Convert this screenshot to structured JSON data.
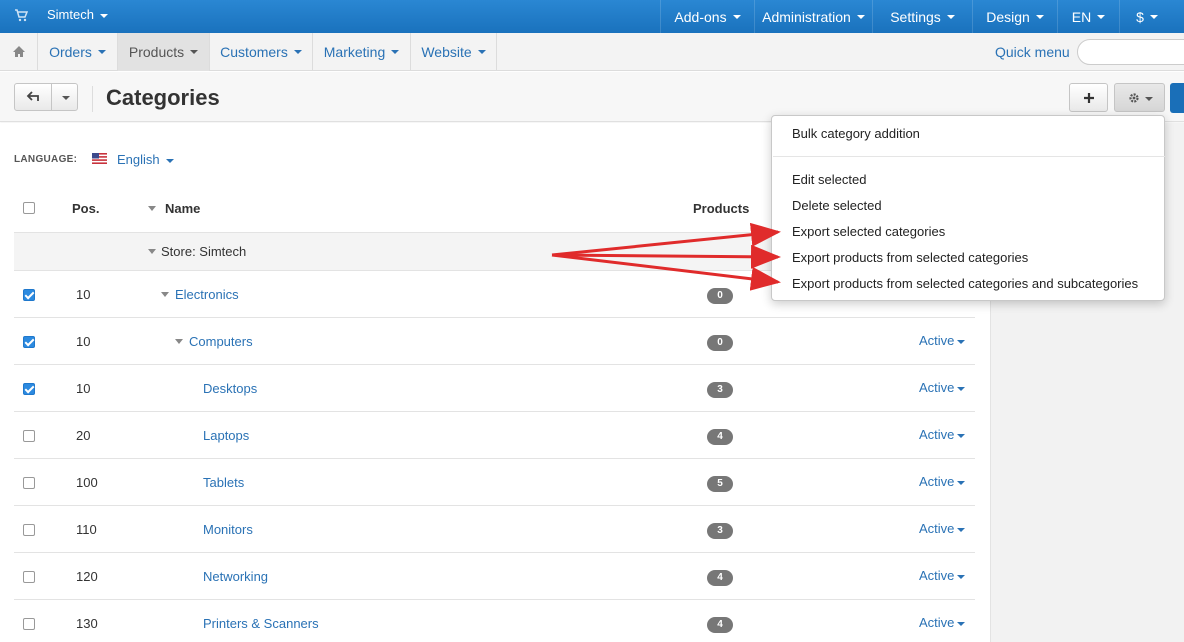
{
  "topbar": {
    "store_name": "Simtech",
    "menu": [
      {
        "label": "Add-ons"
      },
      {
        "label": "Administration"
      },
      {
        "label": "Settings"
      },
      {
        "label": "Design"
      },
      {
        "label": "EN"
      },
      {
        "label": "$"
      }
    ]
  },
  "navbar": {
    "items": [
      {
        "label": "Orders"
      },
      {
        "label": "Products"
      },
      {
        "label": "Customers"
      },
      {
        "label": "Marketing"
      },
      {
        "label": "Website"
      }
    ],
    "active_item": "Products",
    "quick_menu": "Quick menu",
    "search_placeholder": ""
  },
  "page": {
    "title": "Categories",
    "language_label": "LANGUAGE:",
    "language_value": "English"
  },
  "table": {
    "headers": {
      "pos": "Pos.",
      "name": "Name",
      "products": "Products"
    },
    "store_row": "Store: Simtech",
    "rows": [
      {
        "checked": true,
        "pos": "10",
        "name": "Electronics",
        "products": "0",
        "status": ""
      },
      {
        "checked": true,
        "pos": "10",
        "name": "Computers",
        "products": "0",
        "status": "Active"
      },
      {
        "checked": true,
        "pos": "10",
        "name": "Desktops",
        "products": "3",
        "status": "Active"
      },
      {
        "checked": false,
        "pos": "20",
        "name": "Laptops",
        "products": "4",
        "status": "Active"
      },
      {
        "checked": false,
        "pos": "100",
        "name": "Tablets",
        "products": "5",
        "status": "Active"
      },
      {
        "checked": false,
        "pos": "110",
        "name": "Monitors",
        "products": "3",
        "status": "Active"
      },
      {
        "checked": false,
        "pos": "120",
        "name": "Networking",
        "products": "4",
        "status": "Active"
      },
      {
        "checked": false,
        "pos": "130",
        "name": "Printers & Scanners",
        "products": "4",
        "status": "Active"
      }
    ]
  },
  "dropdown": {
    "top_item": "Bulk category addition",
    "items": [
      {
        "label": "Edit selected"
      },
      {
        "label": "Delete selected"
      },
      {
        "label": "Export selected categories"
      },
      {
        "label": "Export products from selected categories"
      },
      {
        "label": "Export products from selected categories and subcategories"
      }
    ]
  },
  "colors": {
    "topbar": "#1e7bc7",
    "link": "#2a72b5",
    "annotation_arrow": "#e02b2b",
    "checkbox_on": "#2c8ae0"
  },
  "icons": [
    "cart-icon",
    "home-icon",
    "back-arrow-icon",
    "plus-icon",
    "gear-icon",
    "us-flag-icon"
  ]
}
